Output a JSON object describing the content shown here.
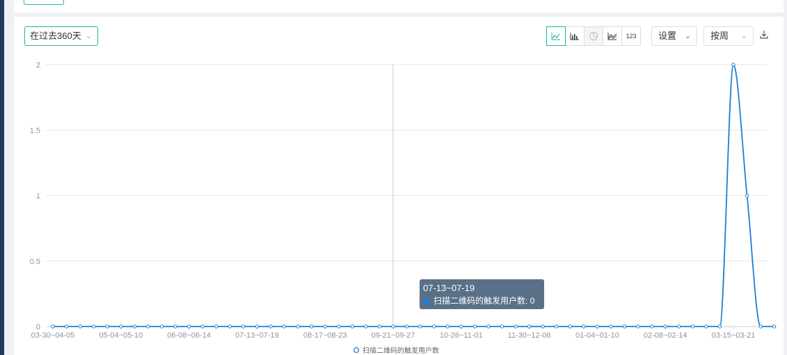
{
  "toolbar": {
    "range_label": "在过去360天",
    "chart_types": [
      {
        "name": "line",
        "icon": "line-chart-icon",
        "active": true
      },
      {
        "name": "bar",
        "icon": "bar-chart-icon",
        "active": false
      },
      {
        "name": "pie",
        "icon": "pie-chart-icon",
        "active": false,
        "disabled": true
      },
      {
        "name": "area",
        "icon": "area-chart-icon",
        "active": false
      },
      {
        "name": "number",
        "label": "123",
        "active": false
      }
    ],
    "settings_label": "设置",
    "period_label": "按周",
    "download_icon": "download-icon"
  },
  "tooltip": {
    "title": "07-13~07-19",
    "series_label": "扫描二维码的触发用户数",
    "value_text": "0"
  },
  "colors": {
    "accent": "#21b3a6",
    "series": "#1c7ed6",
    "tooltip_bg": "#506882"
  },
  "chart_data": {
    "type": "line",
    "smooth": true,
    "ylim": [
      0,
      2
    ],
    "yticks": [
      "0",
      "0.5",
      "1",
      "1.5",
      "2"
    ],
    "x_labels": [
      "03-30~04-05",
      "05-04~05-10",
      "06-08~06-14",
      "07-13~07-19",
      "08-17~08-23",
      "09-21~09-27",
      "10-26~11-01",
      "11-30~12-06",
      "01-04~01-10",
      "02-08~02-14",
      "03-15~03-21"
    ],
    "grid": true,
    "legend_position": "bottom-center",
    "series": [
      {
        "name": "扫描二维码的触发用户数",
        "values": [
          0,
          0,
          0,
          0,
          0,
          0,
          0,
          0,
          0,
          0,
          0,
          0,
          0,
          0,
          0,
          0,
          0,
          0,
          0,
          0,
          0,
          0,
          0,
          0,
          0,
          0,
          0,
          0,
          0,
          0,
          0,
          0,
          0,
          0,
          0,
          0,
          0,
          0,
          0,
          0,
          0,
          0,
          0,
          0,
          0,
          0,
          0,
          0,
          0,
          0,
          2,
          1,
          0,
          0
        ]
      }
    ]
  }
}
